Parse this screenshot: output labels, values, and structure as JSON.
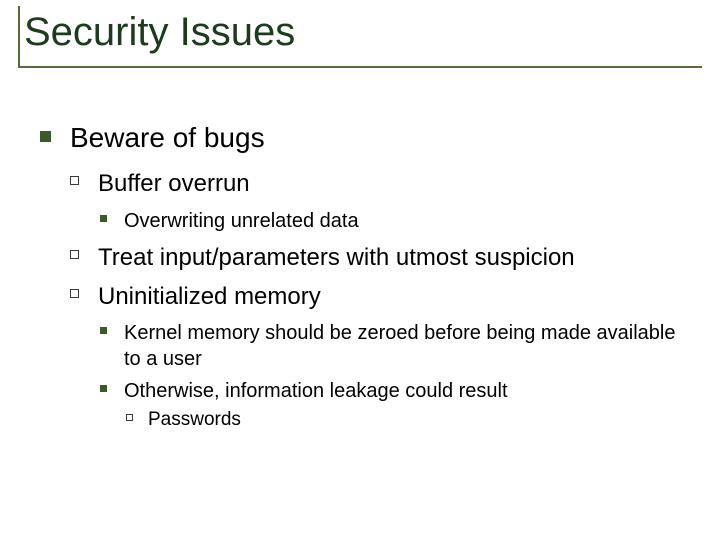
{
  "title": "Security Issues",
  "bullets": {
    "l1": "Beware of bugs",
    "l2a": "Buffer overrun",
    "l3a": "Overwriting unrelated data",
    "l2b": "Treat input/parameters with utmost suspicion",
    "l2c": "Uninitialized memory",
    "l3b": "Kernel memory should be zeroed before being made available to a user",
    "l3c": "Otherwise, information leakage could result",
    "l4a": "Passwords"
  }
}
